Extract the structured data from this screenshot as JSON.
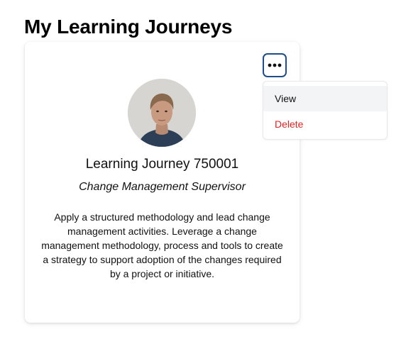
{
  "page": {
    "title": "My Learning Journeys"
  },
  "card": {
    "title": "Learning Journey 750001",
    "role": "Change Management Supervisor",
    "description": "Apply a structured methodology and lead change management activities. Leverage a change management methodology, process and tools to create a strategy to support adoption of the changes required by a project or initiative.",
    "more_icon": "more-horizontal-icon",
    "avatar": "profile-photo"
  },
  "menu": {
    "items": [
      {
        "label": "View"
      },
      {
        "label": "Delete"
      }
    ]
  },
  "colors": {
    "button_border": "#1d4e89",
    "danger": "#dc2626",
    "menu_hover": "#f3f4f6"
  }
}
